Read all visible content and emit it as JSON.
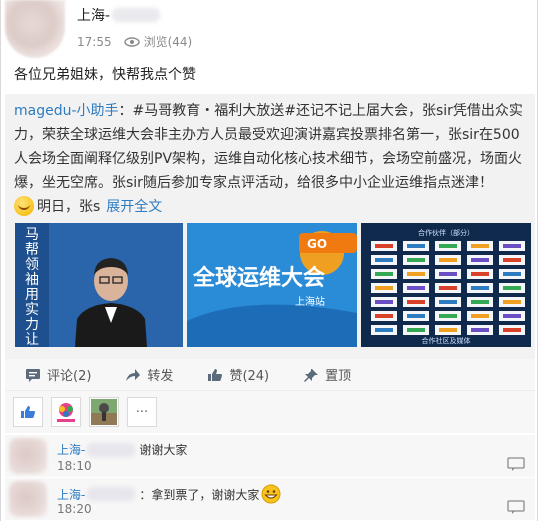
{
  "post": {
    "poster_name": "上海-",
    "time": "17:55",
    "views_label": "浏览(44)",
    "status_text": "各位兄弟姐妹，快帮我点个赞"
  },
  "shared": {
    "author": "magedu-小助手",
    "separator": "：",
    "body": "#马哥教育・福利大放送#还记不记上届大会，张sir凭借出众实力，荣获全球运维大会非主办方人员最受欢迎演讲嘉宾投票排名第一，张sir在500人会场全面阐释亿级别PV架构，运维自动化核心技术细节，会场空前盛况，场面火爆，坐无空席。张sir随后参加专家点评活动，给很多中小企业运维指点迷津！",
    "more_text": "明日，张s",
    "expand_label": "展开全文",
    "image_1_text": "马帮领袖用实力让技术",
    "image_2_text": "全球运维大会",
    "image_2_sub": "上海站",
    "image_3_text": "合作伙伴（部分）",
    "image_3_footer": "合作社区及媒体"
  },
  "actions": {
    "comment_label": "评论(2)",
    "forward_label": "转发",
    "like_label": "赞(24)",
    "pin_label": "置顶"
  },
  "likes": {
    "more_label": "···"
  },
  "comments": [
    {
      "name": "上海-",
      "text": "谢谢大家",
      "time": "18:10"
    },
    {
      "name": "上海-",
      "text": "：拿到票了，谢谢大家",
      "time": "18:20"
    }
  ],
  "colors": {
    "link": "#2e7bbf",
    "card_bg": "#f2f2f2",
    "bar_bg": "#f7f7f7"
  },
  "icons": [
    "eye-icon",
    "comment-icon",
    "forward-icon",
    "like-icon",
    "pin-icon",
    "reply-icon",
    "laugh-emoji-icon"
  ]
}
